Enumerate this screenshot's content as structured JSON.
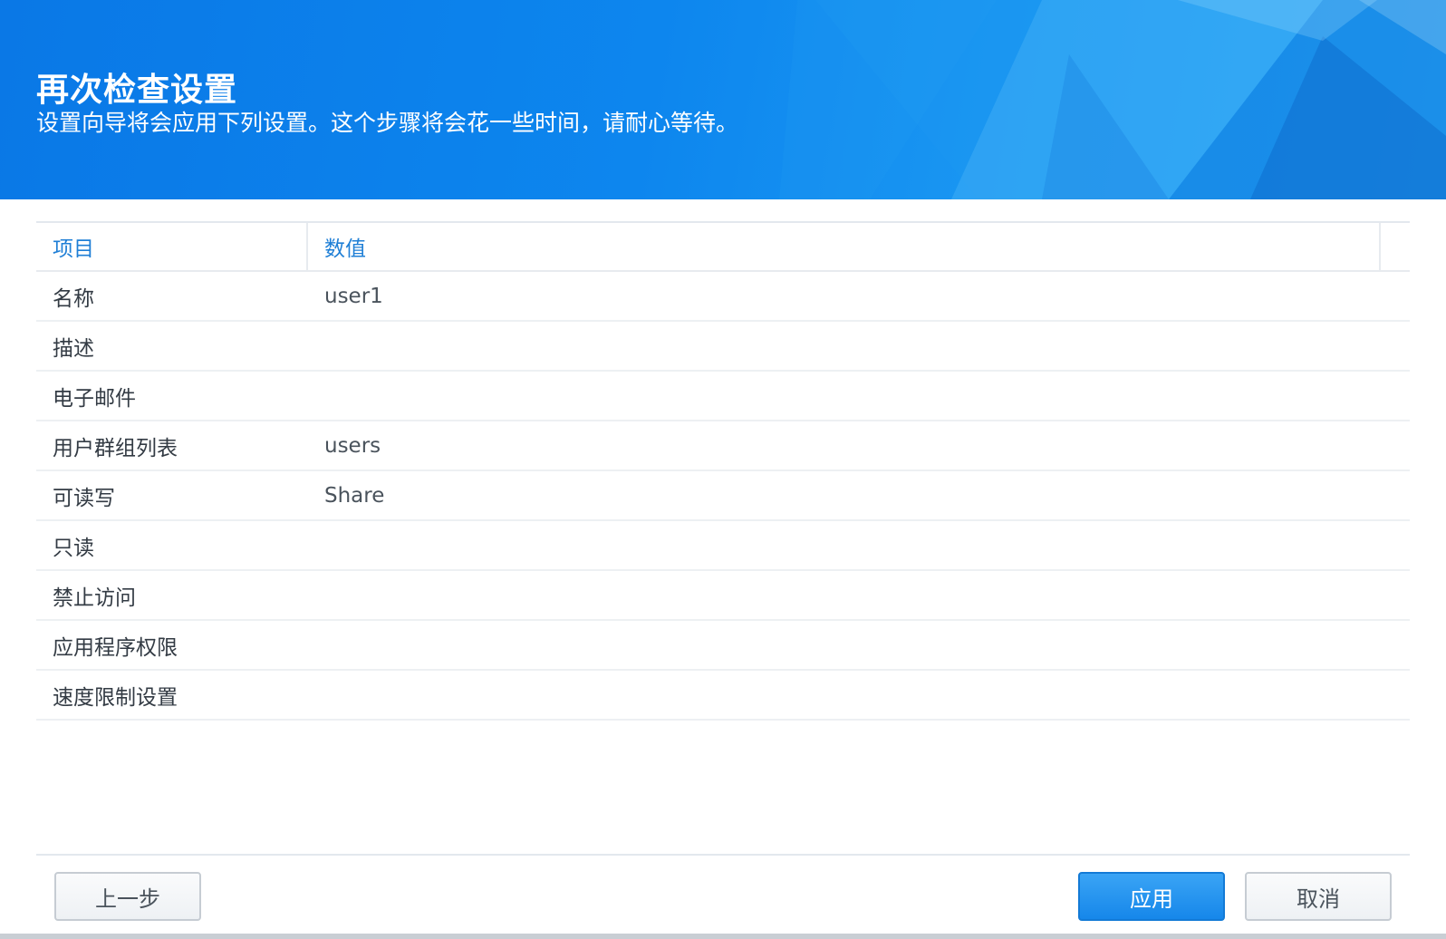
{
  "header": {
    "title": "再次检查设置",
    "subtitle": "设置向导将会应用下列设置。这个步骤将会花一些时间，请耐心等待。"
  },
  "table": {
    "columns": [
      "项目",
      "数值"
    ],
    "rows": [
      {
        "key": "名称",
        "value": "user1"
      },
      {
        "key": "描述",
        "value": ""
      },
      {
        "key": "电子邮件",
        "value": ""
      },
      {
        "key": "用户群组列表",
        "value": "users"
      },
      {
        "key": "可读写",
        "value": "Share"
      },
      {
        "key": "只读",
        "value": ""
      },
      {
        "key": "禁止访问",
        "value": ""
      },
      {
        "key": "应用程序权限",
        "value": ""
      },
      {
        "key": "速度限制设置",
        "value": ""
      }
    ]
  },
  "footer": {
    "prev_label": "上一步",
    "apply_label": "应用",
    "cancel_label": "取消"
  },
  "colors": {
    "banner": "#0d86ee",
    "accent": "#1f7fd6",
    "primary_button": "#1687ea"
  }
}
